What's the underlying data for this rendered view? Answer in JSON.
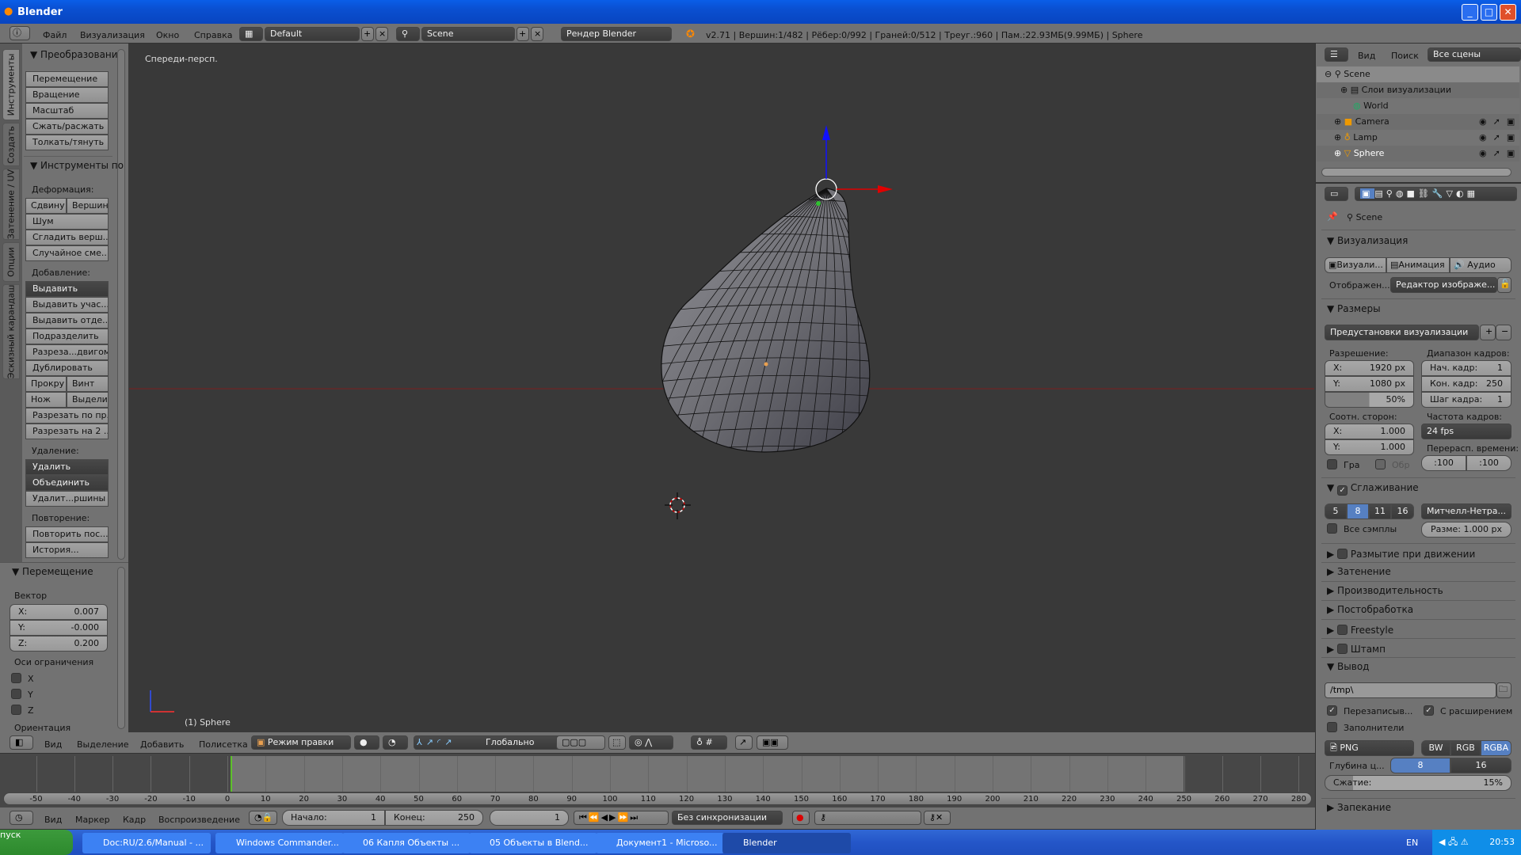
{
  "window": {
    "title": "Blender",
    "minimize": "_",
    "maximize": "□",
    "close": "✕"
  },
  "info_header": {
    "menus": [
      "Файл",
      "Визуализация",
      "Окно",
      "Справка"
    ],
    "layout": "Default",
    "scene": "Scene",
    "engine": "Рендер Blender",
    "stats": "v2.71 | Вершин:1/482 | Рёбер:0/992 | Граней:0/512 | Треуг.:960 | Пам.:22.93МБ(9.99МБ) | Sphere"
  },
  "toolshelf": {
    "tabs": [
      "Инструменты",
      "Создать",
      "Затенение / UV",
      "Опции",
      "Эскизный карандаш"
    ],
    "transform_header": "Преобразовани",
    "transform_buttons": [
      "Перемещение",
      "Вращение",
      "Масштаб",
      "Сжать/расжать",
      "Толкать/тянуть"
    ],
    "mesh_tools_header": "Инструменты по",
    "deform_label": "Деформация:",
    "deform": [
      "Сдвину",
      "Вершин",
      "Шум",
      "Сгладить верш...",
      "Случайное сме..."
    ],
    "add_label": "Добавление:",
    "add": [
      "Выдавить",
      "Выдавить учас...",
      "Выдавить отде...",
      "Подразделить",
      "Разреза...двигом",
      "Дублировать",
      "Прокру",
      "Винт",
      "Нож",
      "Выдели",
      "Разрезать по пр...",
      "Разрезать на 2 ..."
    ],
    "remove_label": "Удаление:",
    "remove": [
      "Удалить",
      "Объединить",
      "Удалит...ршины"
    ],
    "repeat_label": "Повторение:",
    "repeat": [
      "Повторить пос...",
      "История..."
    ]
  },
  "operator": {
    "header": "Перемещение",
    "vector_label": "Вектор",
    "x_label": "X:",
    "x": "0.007",
    "y_label": "Y:",
    "y": "-0.000",
    "z_label": "Z:",
    "z": "0.200",
    "constraint_label": "Оси ограничения",
    "axes": [
      "X",
      "Y",
      "Z"
    ],
    "orientation_label": "Ориентация"
  },
  "viewport": {
    "view_name": "Спереди-персп.",
    "object_name": "(1) Sphere"
  },
  "view_header": {
    "menus": [
      "Вид",
      "Выделение",
      "Добавить",
      "Полисетка"
    ],
    "mode": "Режим правки",
    "orientation": "Глобально"
  },
  "timeline": {
    "ticks": [
      -50,
      -40,
      -30,
      -20,
      -10,
      0,
      10,
      20,
      30,
      40,
      50,
      60,
      70,
      80,
      90,
      100,
      110,
      120,
      130,
      140,
      150,
      160,
      170,
      180,
      190,
      200,
      210,
      220,
      230,
      240,
      250,
      260,
      270,
      280
    ],
    "current_frame": 1,
    "start": 1,
    "end": 250
  },
  "timeline_header": {
    "menus": [
      "Вид",
      "Маркер",
      "Кадр",
      "Воспроизведение"
    ],
    "start_label": "Начало:",
    "start": "1",
    "end_label": "Конец:",
    "end": "250",
    "current": "1",
    "sync": "Без синхронизации"
  },
  "outliner": {
    "menus": [
      "Вид",
      "Поиск"
    ],
    "filter": "Все сцены",
    "rows": [
      "Scene",
      "Слои визуализации",
      "World",
      "Camera",
      "Lamp",
      "Sphere"
    ]
  },
  "properties": {
    "context": "Scene",
    "render": {
      "header": "Визуализация",
      "buttons": [
        "Визуали...",
        "Анимация",
        "Аудио"
      ],
      "display_label": "Отображен...",
      "display": "Редактор изображе..."
    },
    "dimensions": {
      "header": "Размеры",
      "presets": "Предустановки визуализации",
      "resolution_label": "Разрешение:",
      "res_x_label": "X:",
      "res_x": "1920 px",
      "res_y_label": "Y:",
      "res_y": "1080 px",
      "res_pct": "50%",
      "res_pct_value": 50,
      "frame_range_label": "Диапазон кадров:",
      "start_label": "Нач. кадр:",
      "start": "1",
      "end_label": "Кон. кадр:",
      "end": "250",
      "step_label": "Шаг кадра:",
      "step": "1",
      "aspect_label": "Соотн. сторон:",
      "asp_x_label": "X:",
      "asp_x": "1.000",
      "asp_y_label": "Y:",
      "asp_y": "1.000",
      "fps_label": "Частота кадров:",
      "fps": "24 fps",
      "remap_label": "Перерасп. времени:",
      "remap_old": ":100",
      "remap_new": ":100",
      "border": "Гра",
      "crop": "Обр"
    },
    "aa": {
      "header": "Сглаживание",
      "samples": [
        "5",
        "8",
        "11",
        "16"
      ],
      "filter": "Митчелл-Нетра...",
      "all_samples": "Все сэмплы",
      "size": "Разме: 1.000 px"
    },
    "collapsed": [
      "Размытие при движении",
      "Затенение",
      "Производительность",
      "Постобработка",
      "Freestyle",
      "Штамп"
    ],
    "output": {
      "header": "Вывод",
      "path": "/tmp\\",
      "overwrite": "Перезаписыв...",
      "extension": "С расширением",
      "placeholders": "Заполнители",
      "format": "PNG",
      "color_modes": [
        "BW",
        "RGB",
        "RGBA"
      ],
      "depth_label": "Глубина ц...",
      "depths": [
        "8",
        "16"
      ],
      "compression_label": "Сжатие:",
      "compression": "15%",
      "compression_value": 15
    },
    "bake": "Запекание"
  },
  "taskbar": {
    "start": "пуск",
    "items": [
      "Doc:RU/2.6/Manual - ...",
      "Windows Commander...",
      "06 Капля Объекты ...",
      "05 Объекты в Blend...",
      "Документ1 - Microso...",
      "Blender"
    ],
    "lang": "EN",
    "clock": "20:53"
  },
  "colors": {
    "accent": "#5680c2",
    "viewport_bg": "#393939",
    "panel_bg": "#727272",
    "x_axis": "#e00000",
    "z_axis": "#0000ff",
    "current_frame": "#5dc02b"
  }
}
